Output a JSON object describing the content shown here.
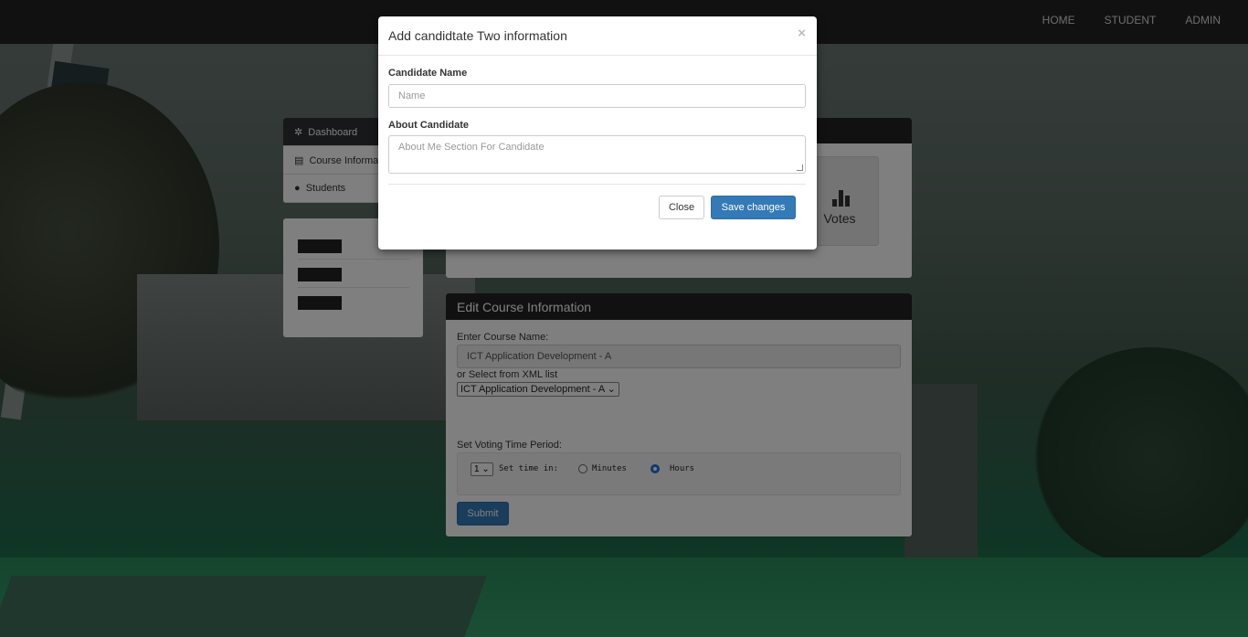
{
  "navbar": {
    "links": [
      "HOME",
      "STUDENT",
      "ADMIN"
    ]
  },
  "sidebar": {
    "items": [
      {
        "label": "Dashboard",
        "icon": "gear-icon",
        "active": true
      },
      {
        "label": "Course Informa",
        "icon": "list-icon",
        "active": false
      },
      {
        "label": "Students",
        "icon": "user-icon",
        "active": false
      }
    ]
  },
  "stats": {
    "tile_label": "Votes",
    "tile_icon": "bar-chart-icon"
  },
  "course_panel": {
    "title": "Edit Course Information",
    "course_name_label": "Enter Course Name:",
    "course_name_value": "ICT Application Development - A",
    "xml_label": "or Select from XML list",
    "xml_selected": "ICT Application Development - A",
    "voting_label": "Set Voting Time Period:",
    "time_value": "1",
    "set_time_text": "Set time in:",
    "minutes_label": "Minutes",
    "hours_label": "Hours",
    "selected_unit": "Hours",
    "submit_label": "Submit"
  },
  "modal": {
    "title": "Add candidtate Two information",
    "close_symbol": "×",
    "name_label": "Candidate Name",
    "name_placeholder": "Name",
    "about_label": "About Candidate",
    "about_placeholder": "About Me Section For Candidate",
    "close_button": "Close",
    "save_button": "Save changes"
  },
  "colors": {
    "navbar": "#222222",
    "primary": "#337ab7",
    "radio_selected": "#1a73e8"
  }
}
